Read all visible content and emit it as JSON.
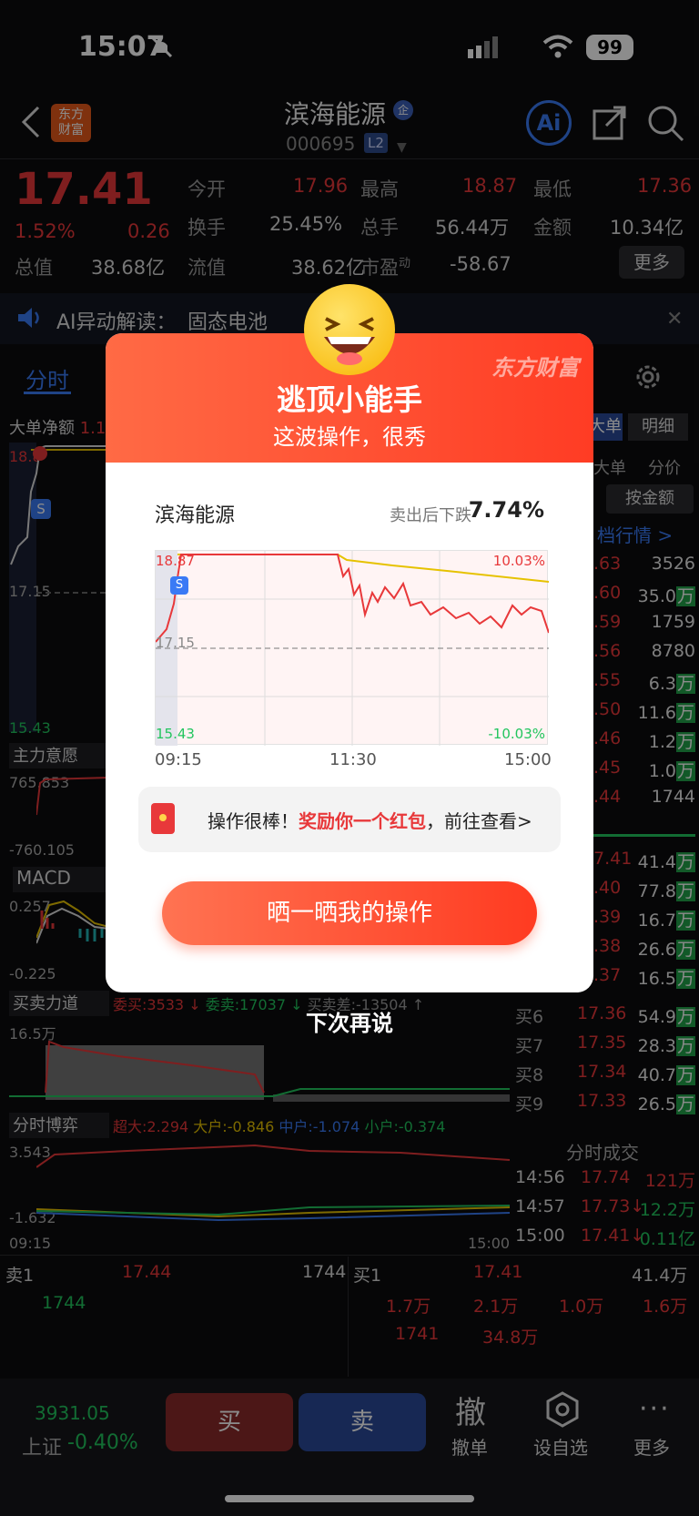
{
  "status": {
    "time": "15:07",
    "battery": "99"
  },
  "header": {
    "title": "滨海能源",
    "code": "000695",
    "level": "L2",
    "logo_line1": "东方",
    "logo_line2": "财富"
  },
  "quote": {
    "price": "17.41",
    "pct": "1.52%",
    "change": "0.26",
    "open_label": "今开",
    "open": "17.96",
    "high_label": "最高",
    "high": "18.87",
    "low_label": "最低",
    "low": "17.36",
    "turnover_label": "换手",
    "turnover": "25.45%",
    "volume_label": "总手",
    "volume": "56.44万",
    "amount_label": "金额",
    "amount": "10.34亿",
    "mcap_label": "总值",
    "mcap": "38.68亿",
    "float_label": "流值",
    "float": "38.62亿",
    "pe_label": "市盈",
    "pe_sup": "动",
    "pe": "-58.67",
    "more": "更多"
  },
  "ai_banner": {
    "text": "AI异动解读：",
    "topic": "固态电池"
  },
  "tabs": {
    "intraday": "分时"
  },
  "left_panels": {
    "big_order": "大单净额",
    "big_order_val": "1.1",
    "top_price": "18.8",
    "mid_price": "17.15",
    "low_price": "15.43",
    "main_intent": "主力意愿",
    "mi_top": "765.853",
    "mi_bottom": "-760.105",
    "macd": "MACD",
    "macd_top": "0.257",
    "macd_bottom": "-0.225",
    "power": "买卖力道",
    "power_buy": "委买:3533 ↓",
    "power_sell": "委卖:17037 ↓",
    "power_diff": "买卖差:-13504 ↑",
    "power_top": "16.5万",
    "game": "分时博弈",
    "game_xl": "超大:2.294",
    "game_l": "大户:-0.846",
    "game_m": "中户:-1.074",
    "game_s": "小户:-0.374",
    "game_top": "3.543",
    "game_bottom": "-1.632",
    "t_start": "09:15",
    "t_end": "15:00"
  },
  "right_panel": {
    "big_btn": "大单",
    "detail_btn": "明细",
    "col1": "大单",
    "col2": "分价",
    "by_amount": "按金额",
    "level_link": "档行情 >",
    "sell_rows": [
      {
        "p": ".63",
        "v": "3526"
      },
      {
        "p": ".60",
        "v": "35.0",
        "u": "万"
      },
      {
        "p": ".59",
        "v": "1759"
      },
      {
        "p": ".56",
        "v": "8780"
      },
      {
        "p": ".55",
        "v": "6.3",
        "u": "万"
      },
      {
        "p": ".50",
        "v": "11.6",
        "u": "万"
      },
      {
        "p": ".46",
        "v": "1.2",
        "u": "万"
      },
      {
        "p": ".45",
        "v": "1.0",
        "u": "万"
      },
      {
        "p": ".44",
        "v": "1744"
      }
    ],
    "buy_rows_top": [
      {
        "p": "7.41",
        "v": "41.4",
        "u": "万"
      },
      {
        "p": ".40",
        "v": "77.8",
        "u": "万"
      },
      {
        "p": ".39",
        "v": "16.7",
        "u": "万"
      },
      {
        "p": ".38",
        "v": "26.6",
        "u": "万"
      },
      {
        "p": ".37",
        "v": "16.5",
        "u": "万"
      }
    ],
    "buy_rows": [
      {
        "l": "买6",
        "p": "17.36",
        "v": "54.9",
        "u": "万"
      },
      {
        "l": "买7",
        "p": "17.35",
        "v": "28.3",
        "u": "万"
      },
      {
        "l": "买8",
        "p": "17.34",
        "v": "40.7",
        "u": "万"
      },
      {
        "l": "买9",
        "p": "17.33",
        "v": "26.5",
        "u": "万"
      }
    ],
    "trades_title": "分时成交",
    "trades": [
      {
        "t": "14:56",
        "p": "17.74",
        "v": "121万"
      },
      {
        "t": "14:57",
        "p": "17.73↓",
        "v": "12.2万"
      },
      {
        "t": "15:00",
        "p": "17.41↓",
        "v": "0.11亿"
      }
    ]
  },
  "bottom_book": {
    "sell1": "卖1",
    "sell1_p": "17.44",
    "sell1_v": "1744",
    "buy1": "买1",
    "buy1_p": "17.41",
    "buy1_v": "41.4万",
    "row2_left": "1744",
    "row2": [
      "1.7万",
      "2.1万",
      "1.0万",
      "1.6万"
    ],
    "row3": [
      "1741",
      "34.8万"
    ]
  },
  "bottom_bar": {
    "index_val": "3931.05",
    "index_name": "上证",
    "index_pct": "-0.40%",
    "buy": "买",
    "sell": "卖",
    "cancel_icon": "撤",
    "cancel": "撤单",
    "watch": "设自选",
    "more": "更多"
  },
  "modal": {
    "brand": "东方财富",
    "title": "逃顶小能手",
    "subtitle": "这波操作，很秀",
    "stock": "滨海能源",
    "drop_label": "卖出后下跌",
    "drop_value": "7.74%",
    "chart_top": "18.87",
    "chart_mid": "17.15",
    "chart_low": "15.43",
    "pct_top": "10.03%",
    "pct_low": "-10.03%",
    "t1": "09:15",
    "t2": "11:30",
    "t3": "15:00",
    "reward_pre": "操作很棒！",
    "reward_hl": "奖励你一个红包",
    "reward_post": "，前往查看>",
    "share": "晒一晒我的操作",
    "later": "下次再说"
  },
  "colors": {
    "up": "#e8383a",
    "down": "#22c55e",
    "accent": "#ff4a2c",
    "sell_btn": "#2a4a9a",
    "buy_btn": "#8a2a2a"
  }
}
